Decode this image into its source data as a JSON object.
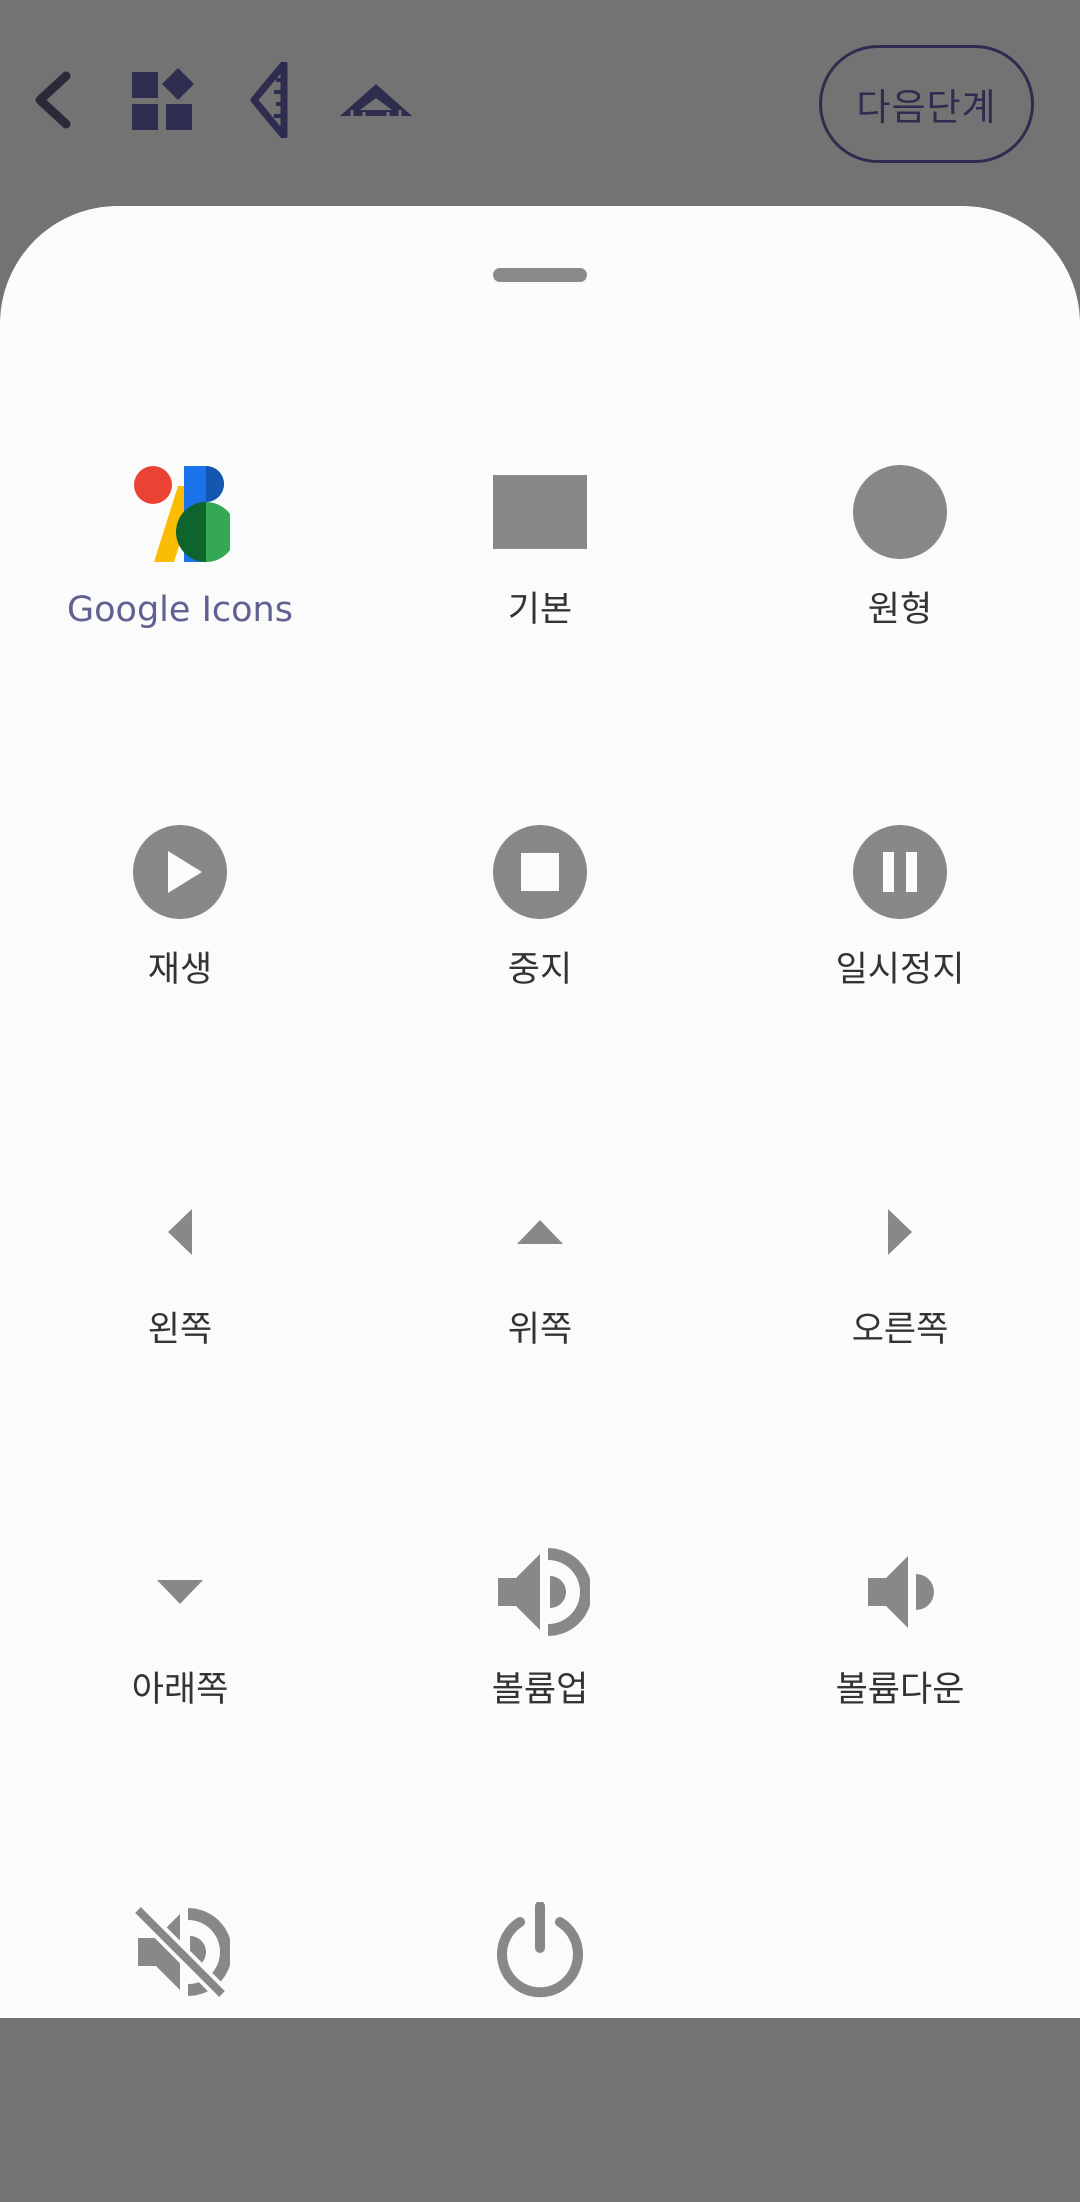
{
  "toolbar": {
    "back_icon": "chevron-left-icon",
    "shapes_icon": "shapes-icon",
    "ruler_angle_icon": "ruler-angle-icon",
    "set_square_icon": "set-square-icon",
    "next_label": "다음단계"
  },
  "colors": {
    "scrim": "#737373",
    "sheet": "#fbfbfb",
    "icon_gray": "#888888",
    "toolbar_dark": "#2e2d4f",
    "google_label": "#5f6291"
  },
  "sheet": {
    "items": [
      {
        "label": "Google Icons",
        "icon": "google-icons-logo"
      },
      {
        "label": "기본",
        "icon": "rectangle-icon"
      },
      {
        "label": "원형",
        "icon": "circle-icon"
      },
      {
        "label": "재생",
        "icon": "play-circle-icon"
      },
      {
        "label": "중지",
        "icon": "stop-circle-icon"
      },
      {
        "label": "일시정지",
        "icon": "pause-circle-icon"
      },
      {
        "label": "왼쪽",
        "icon": "arrow-left-icon"
      },
      {
        "label": "위쪽",
        "icon": "arrow-up-icon"
      },
      {
        "label": "오른쪽",
        "icon": "arrow-right-icon"
      },
      {
        "label": "아래쪽",
        "icon": "arrow-down-icon"
      },
      {
        "label": "볼륨업",
        "icon": "volume-up-icon"
      },
      {
        "label": "볼륨다운",
        "icon": "volume-down-icon"
      },
      {
        "label": "",
        "icon": "volume-off-icon"
      },
      {
        "label": "",
        "icon": "power-icon"
      }
    ]
  }
}
